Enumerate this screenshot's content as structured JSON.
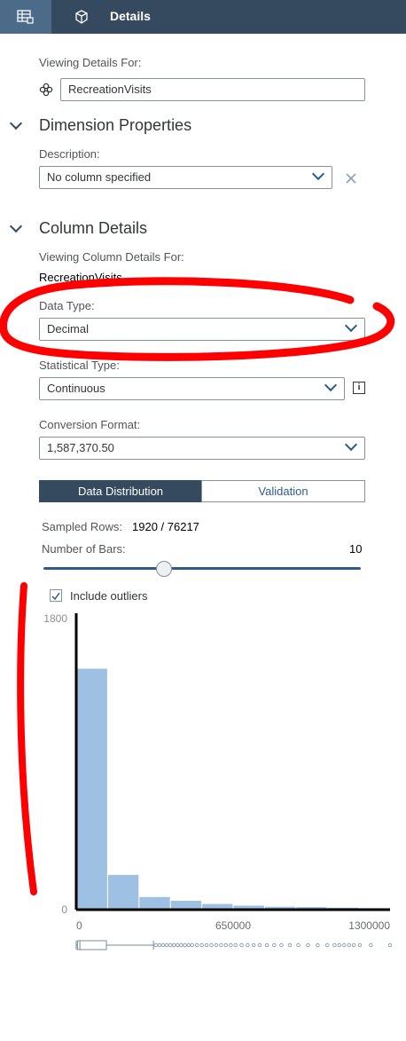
{
  "tabs": {
    "details_label": "Details"
  },
  "viewing": {
    "label": "Viewing Details For:",
    "value": "RecreationVisits"
  },
  "dimension": {
    "title": "Dimension Properties",
    "description_label": "Description:",
    "description_value": "No column specified"
  },
  "column": {
    "title": "Column Details",
    "viewing_label": "Viewing Column Details For:",
    "viewing_value": "RecreationVisits",
    "data_type_label": "Data Type:",
    "data_type_value": "Decimal",
    "stat_type_label": "Statistical Type:",
    "stat_type_value": "Continuous",
    "info_icon_text": "i",
    "conversion_label": "Conversion Format:",
    "conversion_value": "1,587,370.50"
  },
  "distribution": {
    "tab_active": "Data Distribution",
    "tab_inactive": "Validation",
    "sampled_label": "Sampled Rows:",
    "sampled_value": "1920 / 76217",
    "bars_label": "Number of Bars:",
    "bars_value": "10",
    "slider_fraction": 0.38,
    "outliers_label": "Include outliers",
    "outliers_checked": true
  },
  "chart_data": {
    "type": "bar",
    "ylim": [
      0,
      1800
    ],
    "yticks": [
      "1800",
      "0"
    ],
    "xlim": [
      0,
      1300000
    ],
    "xticks": [
      {
        "label": "0",
        "value": 0
      },
      {
        "label": "650000",
        "value": 650000
      },
      {
        "label": "1300000",
        "value": 1300000
      }
    ],
    "bins": [
      {
        "x0": 0,
        "x1": 130000,
        "count": 1490
      },
      {
        "x0": 130000,
        "x1": 260000,
        "count": 215
      },
      {
        "x0": 260000,
        "x1": 390000,
        "count": 78
      },
      {
        "x0": 390000,
        "x1": 520000,
        "count": 55
      },
      {
        "x0": 520000,
        "x1": 650000,
        "count": 35
      },
      {
        "x0": 650000,
        "x1": 780000,
        "count": 25
      },
      {
        "x0": 780000,
        "x1": 910000,
        "count": 18
      },
      {
        "x0": 910000,
        "x1": 1040000,
        "count": 16
      },
      {
        "x0": 1040000,
        "x1": 1170000,
        "count": 12
      },
      {
        "x0": 1170000,
        "x1": 1300000,
        "count": 9
      }
    ],
    "bar_color": "#9ec0e3",
    "boxplot": {
      "whisker_low": 0,
      "q1": 5000,
      "median": 15000,
      "q3": 125000,
      "whisker_high": 320000,
      "outliers": [
        330000,
        345000,
        360000,
        375000,
        390000,
        405000,
        420000,
        435000,
        450000,
        465000,
        480000,
        500000,
        520000,
        540000,
        560000,
        580000,
        600000,
        620000,
        640000,
        660000,
        685000,
        710000,
        735000,
        760000,
        790000,
        820000,
        850000,
        885000,
        920000,
        960000,
        1000000,
        1040000,
        1070000,
        1090000,
        1110000,
        1130000,
        1150000,
        1175000,
        1220000,
        1300000
      ]
    }
  },
  "colors": {
    "header_bg": "#354a5f",
    "accent": "#2e5c8a",
    "active_tab": "#4c6b89"
  }
}
